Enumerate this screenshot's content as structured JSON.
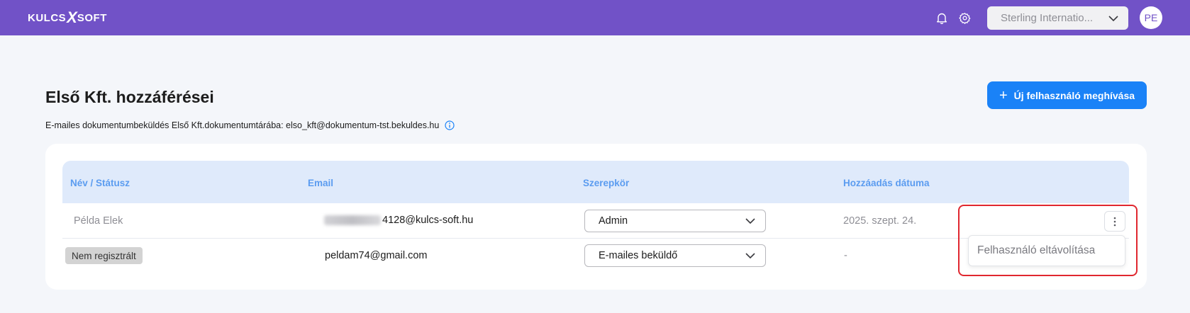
{
  "header": {
    "logo_left": "KULCS",
    "logo_mark": "X",
    "logo_right": "SOFT",
    "company_selector": "Sterling Internatio...",
    "avatar_initials": "PE",
    "bell_icon": "bell-icon",
    "settings_icon": "gear-icon",
    "brand_color": "#7152c7"
  },
  "page": {
    "title": "Első Kft. hozzáférései",
    "subtitle": "E-mailes dokumentumbeküldés Első Kft.dokumentumtárába: elso_kft@dokumentum-tst.bekuldes.hu",
    "invite_button_icon": "+",
    "invite_button": "Új felhasználó meghívása",
    "accent_color": "#1a82f7"
  },
  "table": {
    "columns": [
      "Név / Státusz",
      "Email",
      "Szerepkör",
      "Hozzáadás dátuma"
    ],
    "rows": [
      {
        "name": "Példa Elek",
        "email": "4128@kulcs-soft.hu",
        "role": "Admin",
        "date": "2025. szept. 24."
      },
      {
        "status": "Nem regisztrált",
        "email": "peldam74@gmail.com",
        "role": "E-mailes beküldő",
        "date": "-"
      }
    ]
  },
  "row_menu": {
    "items": [
      "Felhasználó eltávolítása"
    ]
  }
}
